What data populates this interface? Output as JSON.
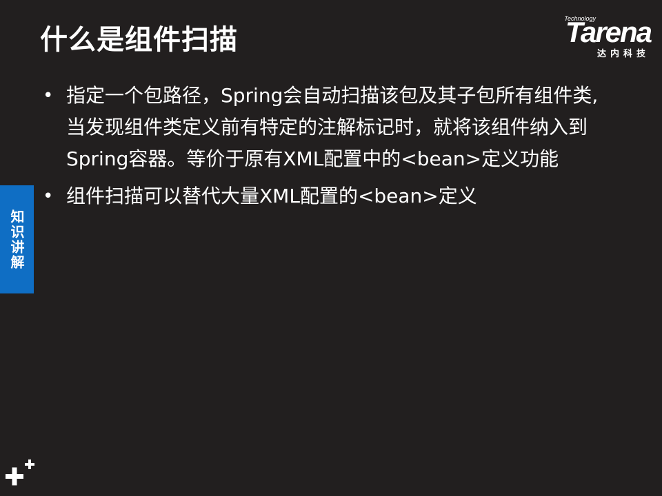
{
  "slide": {
    "title": "什么是组件扫描",
    "bullets": [
      "指定一个包路径，Spring会自动扫描该包及其子包所有组件类,当发现组件类定义前有特定的注解标记时，就将该组件纳入到Spring容器。等价于原有XML配置中的<bean>定义功能",
      "组件扫描可以替代大量XML配置的<bean>定义"
    ],
    "bullet_symbol": "•"
  },
  "logo": {
    "tagline": "Technology",
    "wordmark": "Tarena",
    "chinese": "达内科技"
  },
  "side_tab": {
    "label": "知识讲解"
  },
  "colors": {
    "background": "#221f1f",
    "accent": "#0f6ec4",
    "text": "#ffffff"
  }
}
